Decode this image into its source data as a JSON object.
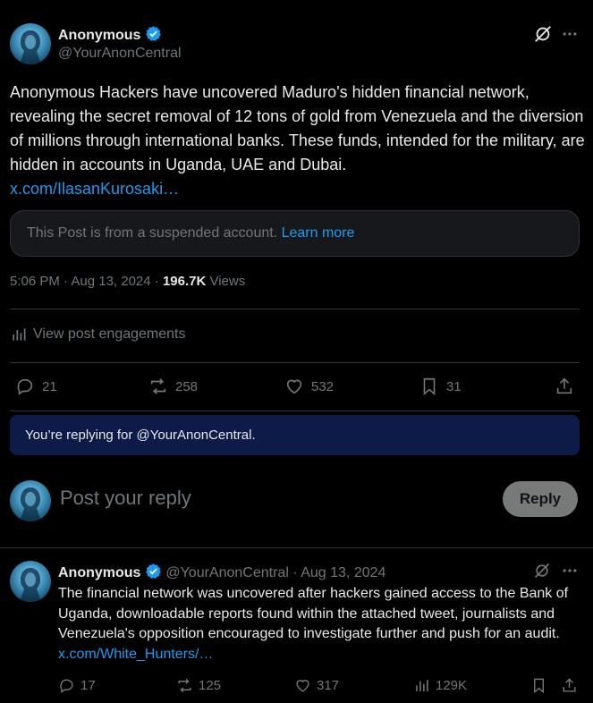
{
  "main_post": {
    "author_name": "Anonymous",
    "author_handle": "@YourAnonCentral",
    "text": "Anonymous Hackers have uncovered Maduro's hidden financial network, revealing the secret removal of 12 tons of gold from Venezuela and the diversion of millions through international banks. These funds, intended for the military, are hidden in accounts in Uganda, UAE and Dubai.",
    "link": "x.com/IlasanKurosaki…",
    "notice_text": "This Post is from a suspended account.",
    "notice_link": "Learn more",
    "timestamp": "5:06 PM · Aug 13, 2024 · ",
    "views_count": "196.7K",
    "views_label": " Views",
    "engagements_label": "View post engagements",
    "replies": "21",
    "reposts": "258",
    "likes": "532",
    "bookmarks": "31"
  },
  "reply_context": {
    "text": "You’re replying for @YourAnonCentral."
  },
  "composer": {
    "placeholder": "Post your reply",
    "button": "Reply"
  },
  "reply_post": {
    "author_name": "Anonymous",
    "author_handle": "@YourAnonCentral",
    "date": " · Aug 13, 2024",
    "text": "The financial network was uncovered after hackers gained access to the Bank of Uganda, downloadable reports found within the attached tweet, journalists and Venezuela's opposition encouraged to investigate further and push for an audit.",
    "link": "x.com/White_Hunters/…",
    "replies": "17",
    "reposts": "125",
    "likes": "317",
    "views": "129K"
  },
  "colors": {
    "background": "#000000",
    "text": "#e7e9ea",
    "secondary": "#71767b",
    "link": "#1d9bf0",
    "verified": "#1d9bf0",
    "divider": "#2f3336",
    "banner": "#0d1b48"
  },
  "icons": [
    "verified-badge-icon",
    "grok-icon",
    "more-icon",
    "analytics-icon",
    "reply-icon",
    "repost-icon",
    "like-icon",
    "bookmark-icon",
    "share-icon"
  ]
}
